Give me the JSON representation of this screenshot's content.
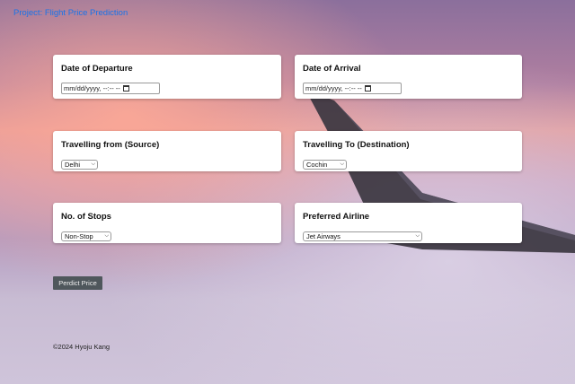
{
  "header": {
    "project_link": "Project: Flight Price Prediction"
  },
  "form": {
    "departure": {
      "label": "Date of Departure",
      "value": "mm/dd/yyyy, --:-- --"
    },
    "arrival": {
      "label": "Date of Arrival",
      "value": "mm/dd/yyyy, --:-- --"
    },
    "source": {
      "label": "Travelling from (Source)",
      "selected": "Delhi"
    },
    "destination": {
      "label": "Travelling To (Destination)",
      "selected": "Cochin"
    },
    "stops": {
      "label": "No. of Stops",
      "selected": "Non-Stop"
    },
    "airline": {
      "label": "Preferred Airline",
      "selected": "Jet Airways"
    },
    "submit_label": "Perdict Price"
  },
  "footer": {
    "text": "©2024 Hyoju Kang"
  },
  "colors": {
    "link": "#1a73e8",
    "button_bg": "#4f575c",
    "card_bg": "#ffffff"
  },
  "icons": {
    "calendar": "calendar-icon",
    "dropdown": "chevron-down-icon"
  }
}
